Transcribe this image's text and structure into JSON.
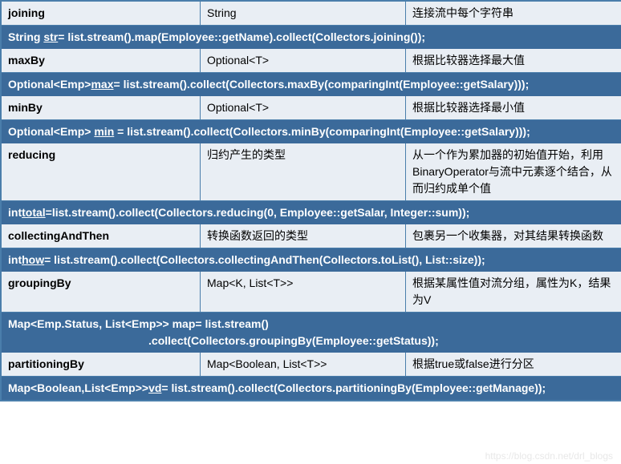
{
  "rows": [
    {
      "name": "joining",
      "ret": "String",
      "desc": "连接流中每个字符串"
    },
    {
      "name": "maxBy",
      "ret": "Optional<T>",
      "desc": "根据比较器选择最大值"
    },
    {
      "name": "minBy",
      "ret": "Optional<T>",
      "desc": "根据比较器选择最小值"
    },
    {
      "name": "reducing",
      "ret": "归约产生的类型",
      "desc": "从一个作为累加器的初始值开始，利用BinaryOperator与流中元素逐个结合，从而归约成单个值"
    },
    {
      "name": "collectingAndThen",
      "ret": "转换函数返回的类型",
      "desc": "包裹另一个收集器，对其结果转换函数"
    },
    {
      "name": "groupingBy",
      "ret": "Map<K, List<T>>",
      "desc": "根据某属性值对流分组，属性为K，结果为V"
    },
    {
      "name": "partitioningBy",
      "ret": "Map<Boolean, List<T>>",
      "desc": "根据true或false进行分区"
    }
  ],
  "code": {
    "c0a": "String ",
    "c0u": "str",
    "c0b": "= list.stream().map(Employee::getName).collect(Collectors.joining());",
    "c1a": "Optional<Emp>",
    "c1u": "max",
    "c1b": "= list.stream().collect(Collectors.maxBy(comparingInt(Employee::getSalary)));",
    "c2a": "Optional<Emp> ",
    "c2u": "min",
    "c2b": " = list.stream().collect(Collectors.minBy(comparingInt(Employee::getSalary)));",
    "c3a": "int",
    "c3u": "total",
    "c3b": "=list.stream().collect(Collectors.reducing(0, Employee::getSalar, Integer::sum));",
    "c4a": "int",
    "c4u": "how",
    "c4b": "= list.stream().collect(Collectors.collectingAndThen(Collectors.toList(), List::size));",
    "c5": "Map<Emp.Status, List<Emp>> map= list.stream()\n                                             .collect(Collectors.groupingBy(Employee::getStatus));",
    "c6a": "Map<Boolean,List<Emp>>",
    "c6u": "vd",
    "c6b": "= list.stream().collect(Collectors.partitioningBy(Employee::getManage));"
  },
  "watermark": "https://blog.csdn.net/drl_blogs"
}
